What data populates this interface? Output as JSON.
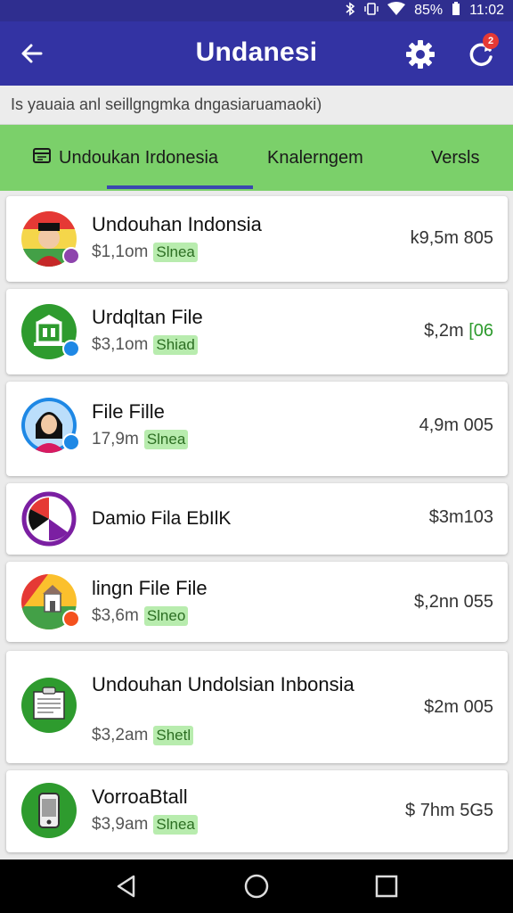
{
  "status_bar": {
    "battery": "85%",
    "time": "11:02",
    "icons": [
      "bluetooth-icon",
      "vibrate-icon",
      "wifi-icon",
      "battery-icon"
    ]
  },
  "app_bar": {
    "title": "Undanesi",
    "notification_count": "2"
  },
  "subtitle": "Is yauaia anl seillgngmka dngasiaruamaoki)",
  "tabs": [
    {
      "label": "Undoukan Irdonesia"
    },
    {
      "label": "Knalerngem"
    },
    {
      "label": "Versls"
    }
  ],
  "items": [
    {
      "title": "Undouhan Indonsia",
      "size": "$1,1om",
      "tag": "Slnea",
      "right": "k9,5m 805",
      "accent": "",
      "icon": "person-avatar"
    },
    {
      "title": "Urdqltan File",
      "size": "$3,1om",
      "tag": "Shiad",
      "right": "$,2m",
      "accent": "[06",
      "icon": "building-icon"
    },
    {
      "title": "File Fille",
      "size": "17,9m",
      "tag": "Slnea",
      "right": "4,9m 005",
      "accent": "",
      "icon": "woman-avatar"
    },
    {
      "title": "Damio Fila EbIlK",
      "size": "",
      "tag": "",
      "right": "$3m103",
      "accent": "",
      "icon": "flag-icon"
    },
    {
      "title": "lingn File File",
      "size": "$3,6m",
      "tag": "Slneo",
      "right": "$,2nn 055",
      "accent": "",
      "icon": "landmark-icon"
    },
    {
      "title": "Undouhan Undolsian Inbonsia",
      "size": "$3,2am",
      "tag": "Shetl",
      "right": "$2m 005",
      "accent": "",
      "icon": "document-icon"
    },
    {
      "title": "VorroaBtall",
      "size": "$3,9am",
      "tag": "Slnea",
      "right": "$ 7hm 5G5",
      "accent": "",
      "icon": "phone-icon"
    }
  ],
  "colors": {
    "app_bar": "#3333a3",
    "tab_bar": "#7bd06a",
    "tag_bg": "#b8ecae",
    "accent_green": "#2e9b2e"
  }
}
